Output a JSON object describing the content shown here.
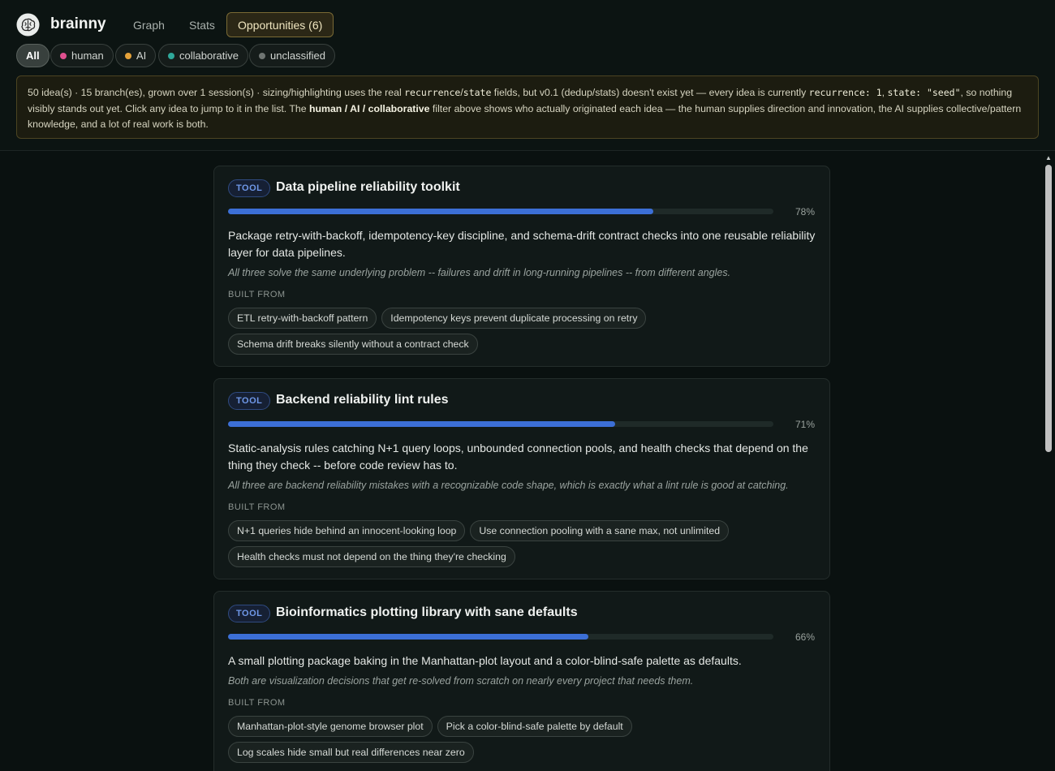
{
  "app": {
    "name": "brainny"
  },
  "nav": {
    "tabs": [
      {
        "label": "Graph"
      },
      {
        "label": "Stats"
      },
      {
        "label": "Opportunities (6)"
      }
    ]
  },
  "filters": [
    {
      "label": "All"
    },
    {
      "label": "human",
      "color": "#e0508f"
    },
    {
      "label": "AI",
      "color": "#e5a23a"
    },
    {
      "label": "collaborative",
      "color": "#2fa89a"
    },
    {
      "label": "unclassified",
      "color": "#6f7572"
    }
  ],
  "notice": {
    "p1": "50 idea(s) · 15 branch(es), grown over 1 session(s) · sizing/highlighting uses the real ",
    "code1": "recurrence",
    "p2": "/",
    "code2": "state",
    "p3": " fields, but v0.1 (dedup/stats) doesn't exist yet — every idea is currently ",
    "code3": "recurrence: 1",
    "p4": ", ",
    "code4": "state: \"seed\"",
    "p5": ", so nothing visibly stands out yet. Click any idea to jump to it in the list. The ",
    "bold": "human / AI / collaborative",
    "p6": " filter above shows who actually originated each idea — the human supplies direction and innovation, the AI supplies collective/pattern knowledge, and a lot of real work is both."
  },
  "built_from_label": "BUILT FROM",
  "opportunities": [
    {
      "badge": "TOOL",
      "title": "Data pipeline reliability toolkit",
      "score": 0.78,
      "score_label": "78%",
      "description": "Package retry-with-backoff, idempotency-key discipline, and schema-drift contract checks into one reusable reliability layer for data pipelines.",
      "rationale": "All three solve the same underlying problem -- failures and drift in long-running pipelines -- from different angles.",
      "sources": [
        "ETL retry-with-backoff pattern",
        "Idempotency keys prevent duplicate processing on retry",
        "Schema drift breaks silently without a contract check"
      ]
    },
    {
      "badge": "TOOL",
      "title": "Backend reliability lint rules",
      "score": 0.71,
      "score_label": "71%",
      "description": "Static-analysis rules catching N+1 query loops, unbounded connection pools, and health checks that depend on the thing they check -- before code review has to.",
      "rationale": "All three are backend reliability mistakes with a recognizable code shape, which is exactly what a lint rule is good at catching.",
      "sources": [
        "N+1 queries hide behind an innocent-looking loop",
        "Use connection pooling with a sane max, not unlimited",
        "Health checks must not depend on the thing they're checking"
      ]
    },
    {
      "badge": "TOOL",
      "title": "Bioinformatics plotting library with sane defaults",
      "score": 0.66,
      "score_label": "66%",
      "description": "A small plotting package baking in the Manhattan-plot layout and a color-blind-safe palette as defaults.",
      "rationale": "Both are visualization decisions that get re-solved from scratch on nearly every project that needs them.",
      "sources": [
        "Manhattan-plot-style genome browser plot",
        "Pick a color-blind-safe palette by default",
        "Log scales hide small but real differences near zero"
      ]
    }
  ]
}
